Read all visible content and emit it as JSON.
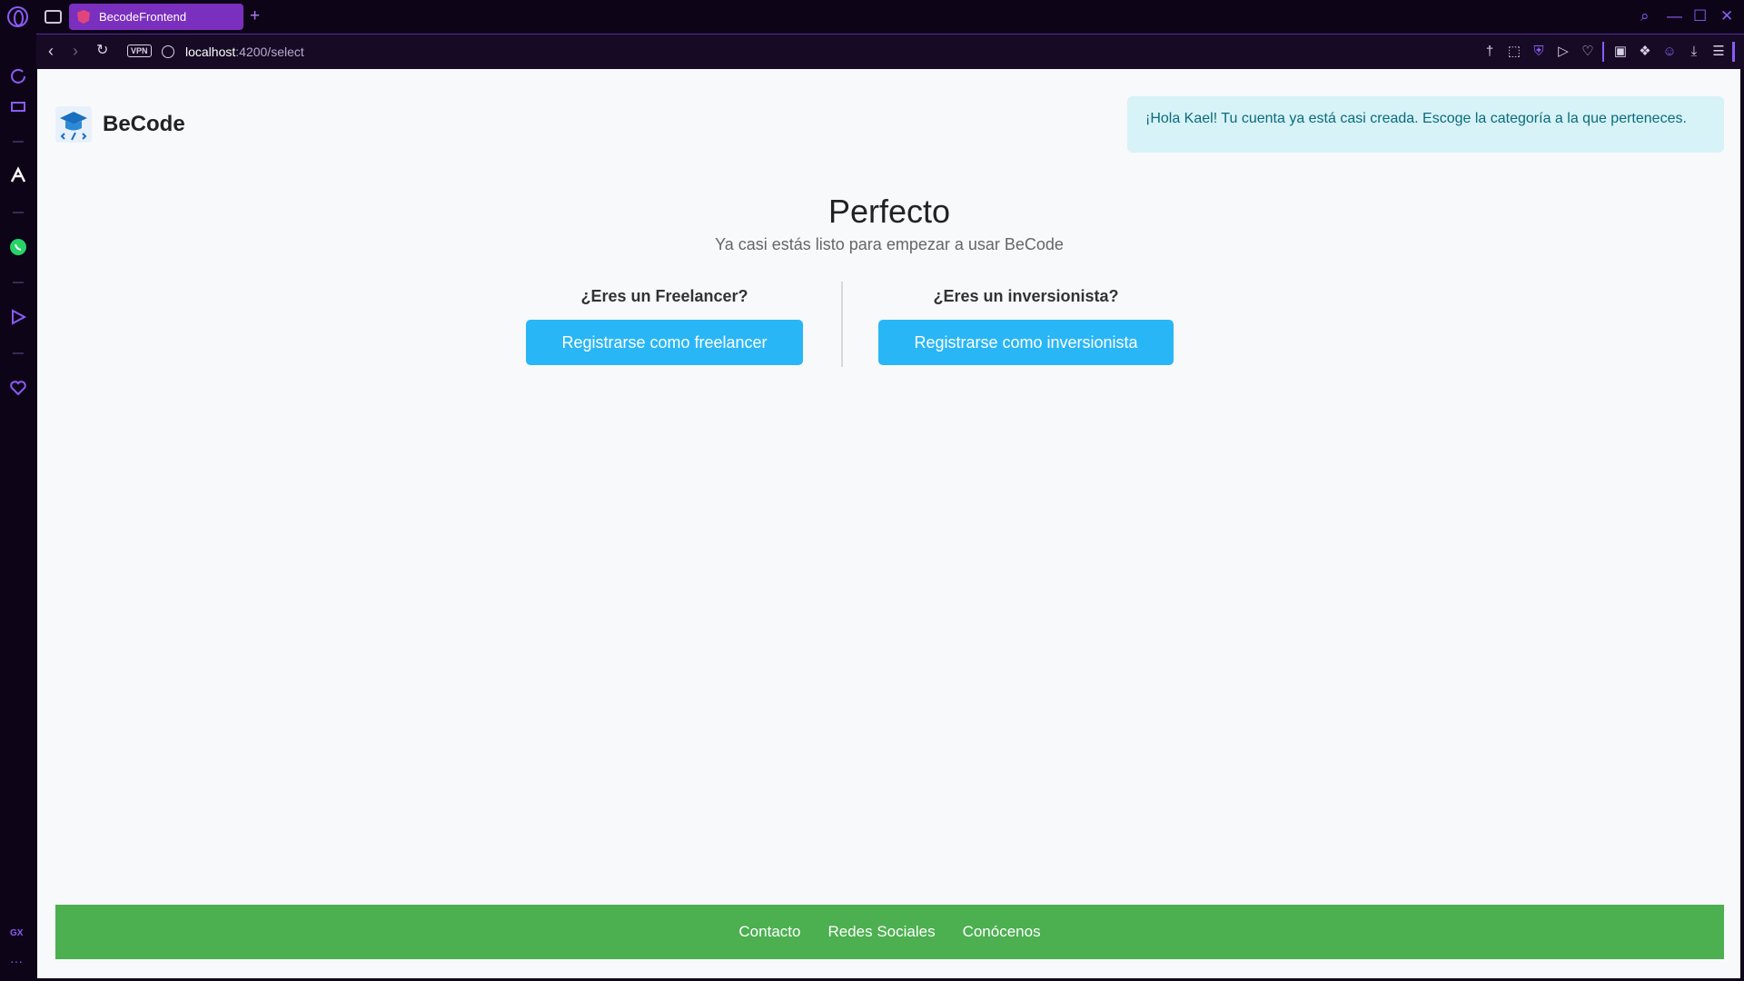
{
  "browser": {
    "tab_title": "BecodeFrontend",
    "new_tab_glyph": "+",
    "url_host": "localhost",
    "url_path": ":4200/select",
    "vpn_label": "VPN",
    "accent_color": "#8b5cf6",
    "sidebar_gx_label": "GX",
    "sidebar_more_glyph": "···"
  },
  "page": {
    "brand_name": "BeCode",
    "alert_text": "¡Hola Kael! Tu cuenta ya está casi creada. Escoge la categoría a la que perteneces.",
    "title": "Perfecto",
    "subtitle": "Ya casi estás listo para empezar a usar BeCode",
    "freelancer": {
      "question": "¿Eres un Freelancer?",
      "button": "Registrarse como freelancer"
    },
    "investor": {
      "question": "¿Eres un inversionista?",
      "button": "Registrarse como inversionista"
    },
    "button_color": "#29b6f6",
    "footer_color": "#4caf50",
    "footer_links": [
      "Contacto",
      "Redes Sociales",
      "Conócenos"
    ]
  }
}
